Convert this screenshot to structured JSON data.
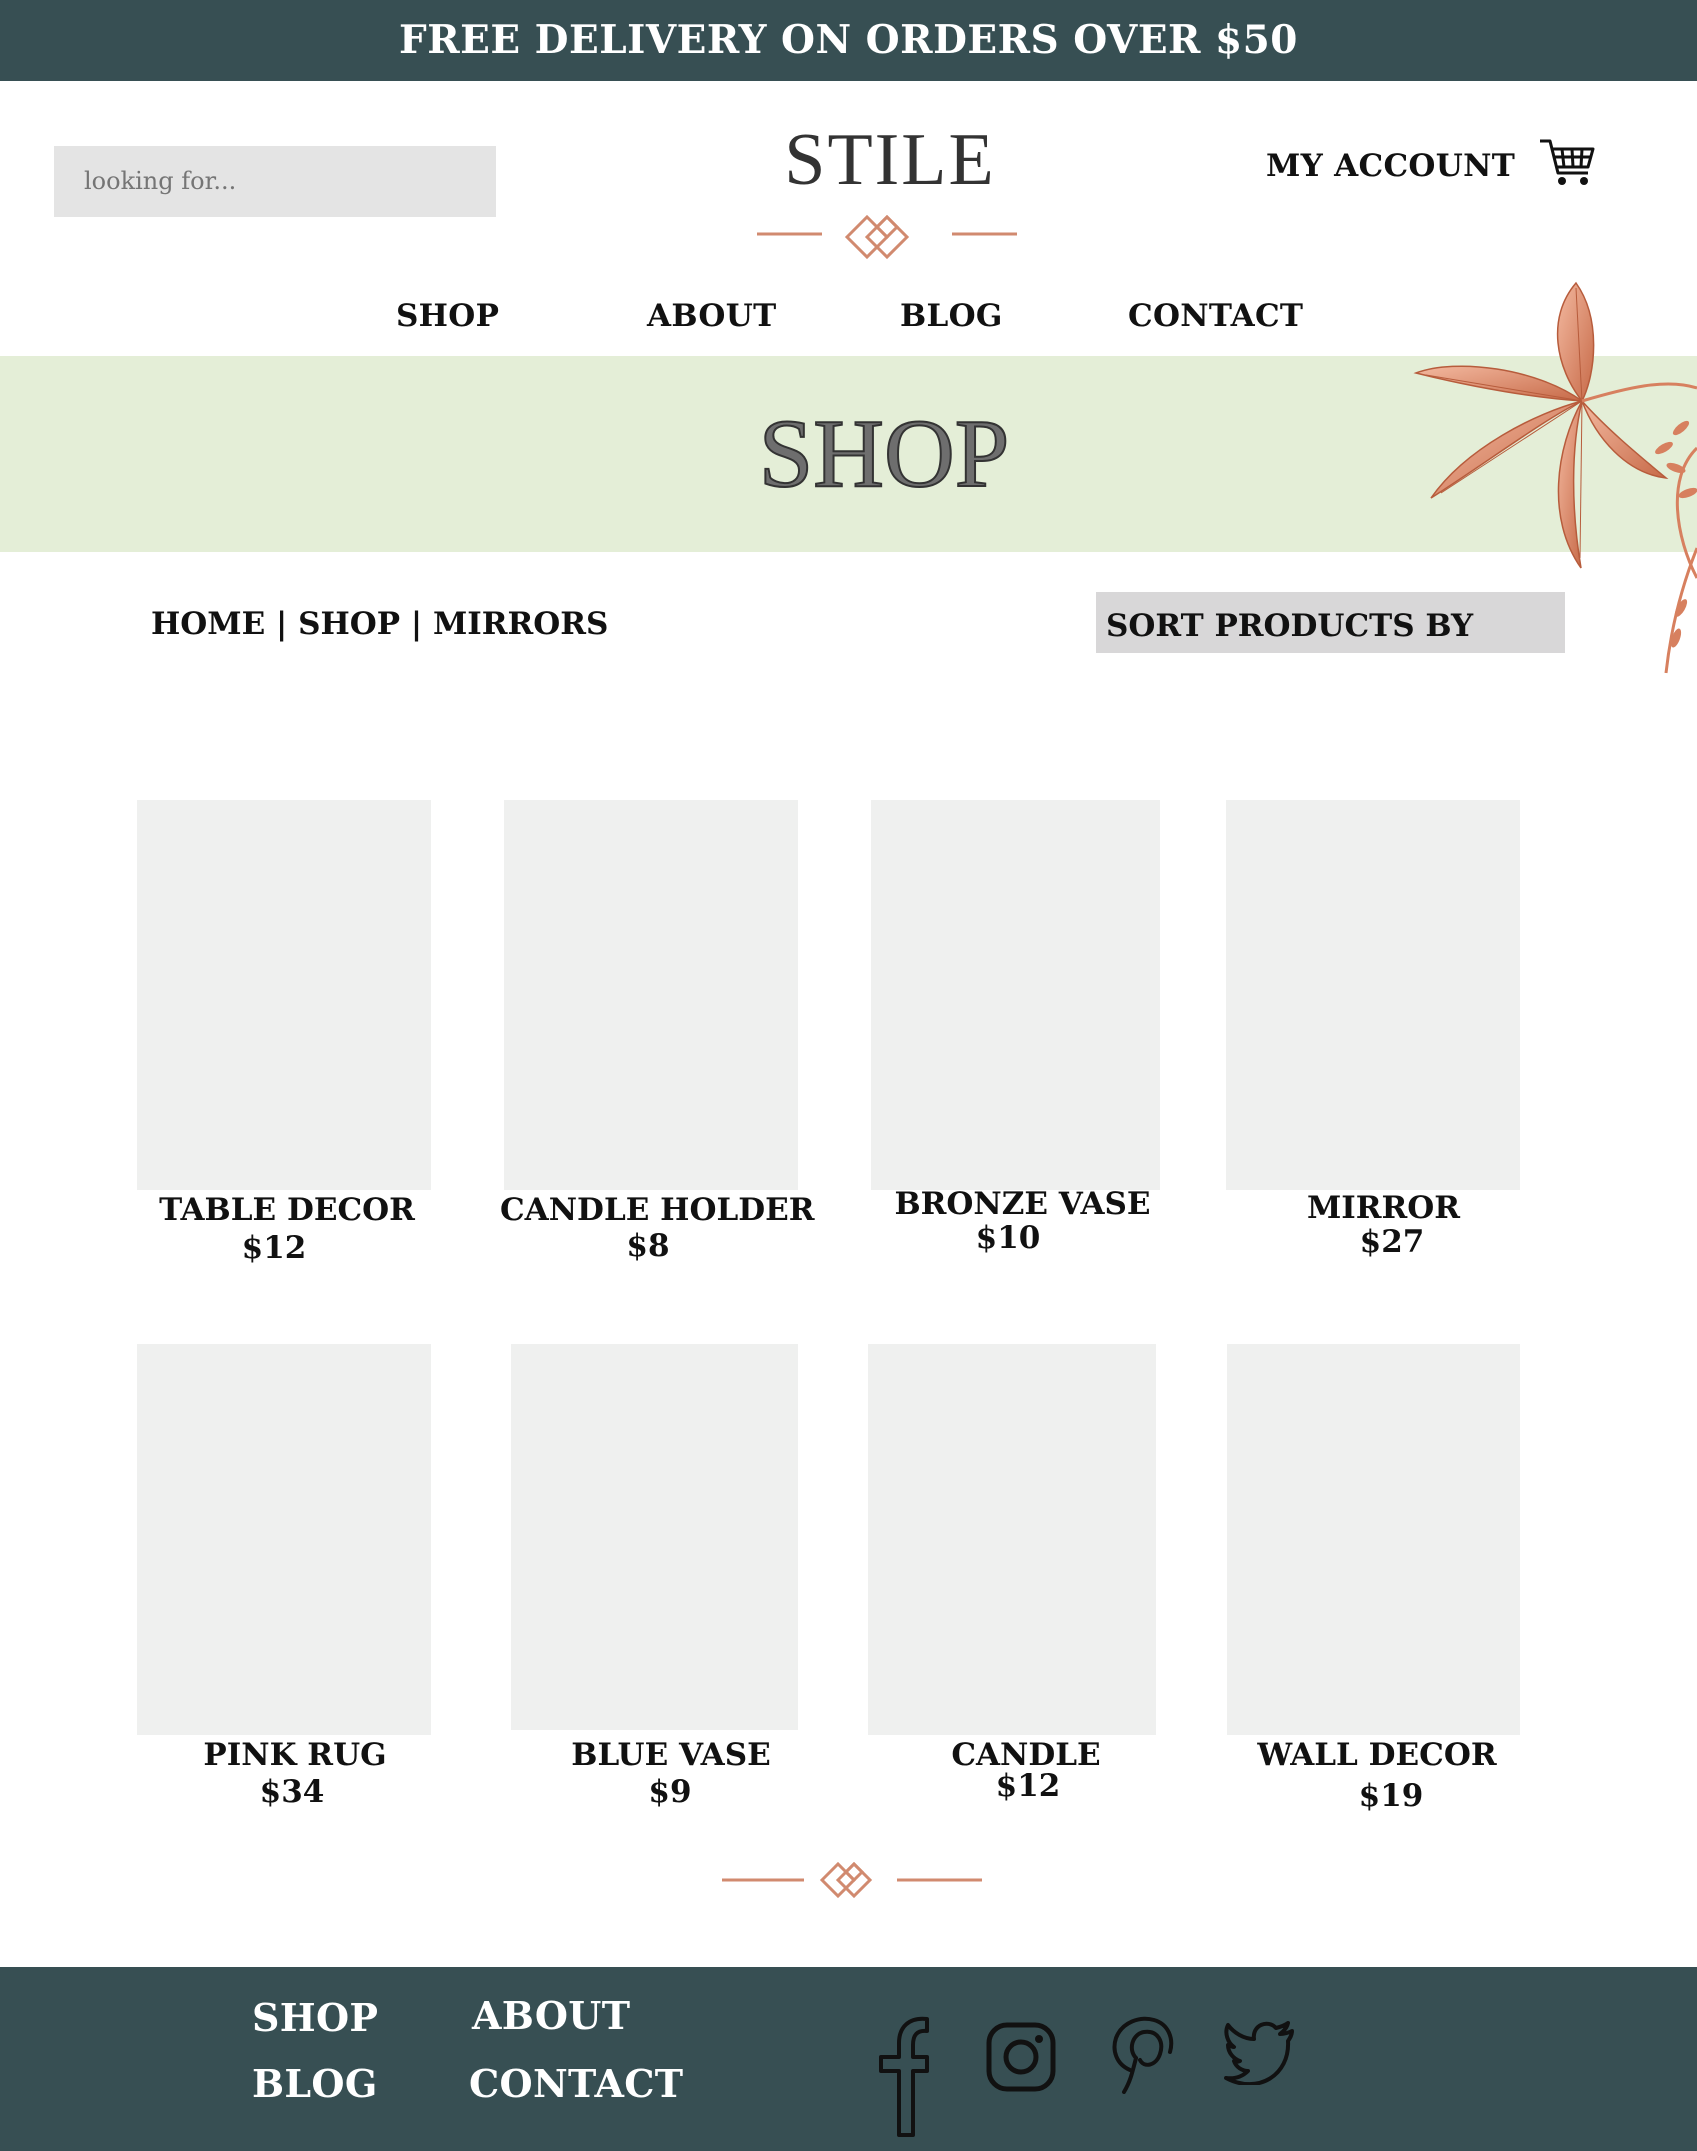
{
  "colors": {
    "dark": "#374f53",
    "hero": "#e4eed7",
    "placeholder": "#eff0ef",
    "accent": "#d18a6f"
  },
  "banner": {
    "text": "FREE DELIVERY ON ORDERS OVER $50"
  },
  "header": {
    "search_placeholder": "looking for...",
    "logo": "STILE",
    "account_label": "MY ACCOUNT",
    "cart_icon": "cart-icon"
  },
  "nav": {
    "items": [
      {
        "label": "SHOP"
      },
      {
        "label": "ABOUT"
      },
      {
        "label": "BLOG"
      },
      {
        "label": "CONTACT"
      }
    ]
  },
  "hero": {
    "title": "SHOP"
  },
  "breadcrumb": {
    "text": "HOME | SHOP | MIRRORS"
  },
  "sort": {
    "label": "SORT PRODUCTS BY"
  },
  "products": [
    {
      "name": "TABLE DECOR",
      "price": "$12"
    },
    {
      "name": "CANDLE HOLDER",
      "price": "$8"
    },
    {
      "name": "BRONZE VASE",
      "price": "$10"
    },
    {
      "name": "MIRROR",
      "price": "$27"
    },
    {
      "name": "PINK RUG",
      "price": "$34"
    },
    {
      "name": "BLUE VASE",
      "price": "$9"
    },
    {
      "name": "CANDLE",
      "price": "$12"
    },
    {
      "name": "WALL DECOR",
      "price": "$19"
    }
  ],
  "footer": {
    "links": [
      {
        "label": "SHOP"
      },
      {
        "label": "ABOUT"
      },
      {
        "label": "BLOG"
      },
      {
        "label": "CONTACT"
      }
    ],
    "social_icons": [
      "facebook-icon",
      "instagram-icon",
      "pinterest-icon",
      "twitter-icon"
    ]
  }
}
